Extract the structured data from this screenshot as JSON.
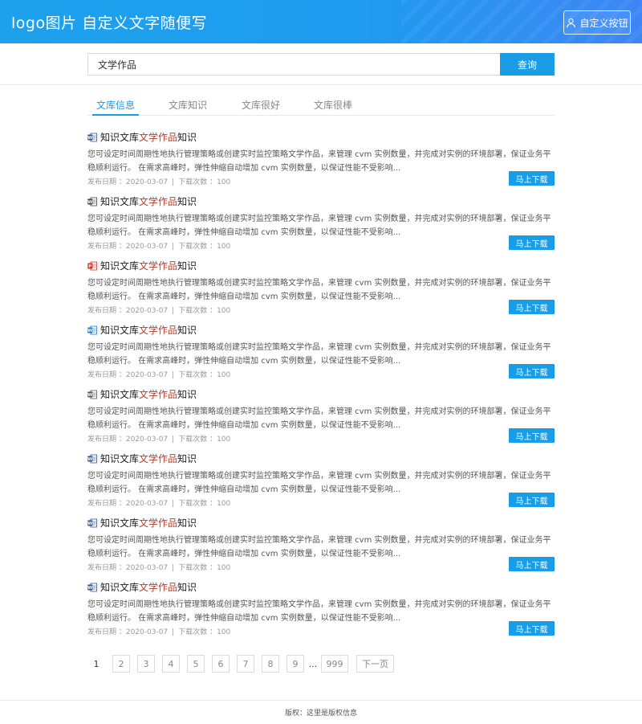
{
  "header": {
    "logo_text": "logo图片 自定义文字随便写",
    "custom_button_label": "自定义按钮",
    "accent": "#1da1ec"
  },
  "search": {
    "value": "文学作品",
    "button_label": "查询"
  },
  "tabs": [
    {
      "label": "文库信息",
      "active": true
    },
    {
      "label": "文库知识",
      "active": false
    },
    {
      "label": "文库很好",
      "active": false
    },
    {
      "label": "文库很棒",
      "active": false
    }
  ],
  "items": [
    {
      "icon": "word-doc-icon",
      "icon_color": "#2b5797",
      "title_prefix": "知识文库",
      "title_highlight": "文学作品",
      "title_suffix": "知识",
      "description": "您可设定时间周期性地执行管理策略或创建实时监控策略文学作品，来管理 cvm 实例数量，并完成对实例的环境部署，保证业务平稳顺利运行。 在需求高峰时，弹性伸缩自动增加 cvm 实例数量，以保证性能不受影响...",
      "date_label": "发布日期 ：2020-03-07",
      "downloads_label": "下载次数 ：100",
      "download_button": "马上下载"
    },
    {
      "icon": "word-doc-icon",
      "icon_color": "#444444",
      "title_prefix": "知识文库",
      "title_highlight": "文学作品",
      "title_suffix": "知识",
      "description": "您可设定时间周期性地执行管理策略或创建实时监控策略文学作品，来管理 cvm 实例数量，并完成对实例的环境部署，保证业务平稳顺利运行。 在需求高峰时，弹性伸缩自动增加 cvm 实例数量，以保证性能不受影响...",
      "date_label": "发布日期 ：2020-03-07",
      "downloads_label": "下载次数 ：100",
      "download_button": "马上下载"
    },
    {
      "icon": "ppt-doc-icon",
      "icon_color": "#c0392b",
      "title_prefix": "知识文库",
      "title_highlight": "文学作品",
      "title_suffix": "知识",
      "description": "您可设定时间周期性地执行管理策略或创建实时监控策略文学作品，来管理 cvm 实例数量，并完成对实例的环境部署，保证业务平稳顺利运行。 在需求高峰时，弹性伸缩自动增加 cvm 实例数量，以保证性能不受影响...",
      "date_label": "发布日期 ：2020-03-07",
      "downloads_label": "下载次数 ：100",
      "download_button": "马上下载"
    },
    {
      "icon": "word-doc-icon",
      "icon_color": "#1a7bd5",
      "title_prefix": "知识文库",
      "title_highlight": "文学作品",
      "title_suffix": "知识",
      "description": "您可设定时间周期性地执行管理策略或创建实时监控策略文学作品，来管理 cvm 实例数量，并完成对实例的环境部署，保证业务平稳顺利运行。 在需求高峰时，弹性伸缩自动增加 cvm 实例数量，以保证性能不受影响...",
      "date_label": "发布日期 ：2020-03-07",
      "downloads_label": "下载次数 ：100",
      "download_button": "马上下载"
    },
    {
      "icon": "word-doc-icon",
      "icon_color": "#555555",
      "title_prefix": "知识文库",
      "title_highlight": "文学作品",
      "title_suffix": "知识",
      "description": "您可设定时间周期性地执行管理策略或创建实时监控策略文学作品，来管理 cvm 实例数量，并完成对实例的环境部署，保证业务平稳顺利运行。 在需求高峰时，弹性伸缩自动增加 cvm 实例数量，以保证性能不受影响...",
      "date_label": "发布日期 ：2020-03-07",
      "downloads_label": "下载次数 ：100",
      "download_button": "马上下载"
    },
    {
      "icon": "word-doc-icon",
      "icon_color": "#2b5797",
      "title_prefix": "知识文库",
      "title_highlight": "文学作品",
      "title_suffix": "知识",
      "description": "您可设定时间周期性地执行管理策略或创建实时监控策略文学作品，来管理 cvm 实例数量，并完成对实例的环境部署，保证业务平稳顺利运行。 在需求高峰时，弹性伸缩自动增加 cvm 实例数量，以保证性能不受影响...",
      "date_label": "发布日期 ：2020-03-07",
      "downloads_label": "下载次数 ：100",
      "download_button": "马上下载"
    },
    {
      "icon": "word-doc-icon",
      "icon_color": "#2b5797",
      "title_prefix": "知识文库",
      "title_highlight": "文学作品",
      "title_suffix": "知识",
      "description": "您可设定时间周期性地执行管理策略或创建实时监控策略文学作品，来管理 cvm 实例数量，并完成对实例的环境部署，保证业务平稳顺利运行。 在需求高峰时，弹性伸缩自动增加 cvm 实例数量，以保证性能不受影响...",
      "date_label": "发布日期 ：2020-03-07",
      "downloads_label": "下载次数 ：100",
      "download_button": "马上下载"
    },
    {
      "icon": "word-doc-icon",
      "icon_color": "#2b5797",
      "title_prefix": "知识文库",
      "title_highlight": "文学作品",
      "title_suffix": "知识",
      "description": "您可设定时间周期性地执行管理策略或创建实时监控策略文学作品，来管理 cvm 实例数量，并完成对实例的环境部署，保证业务平稳顺利运行。 在需求高峰时，弹性伸缩自动增加 cvm 实例数量，以保证性能不受影响...",
      "date_label": "发布日期 ：2020-03-07",
      "downloads_label": "下载次数 ：100",
      "download_button": "马上下载"
    }
  ],
  "pagination": {
    "pages": [
      "1",
      "2",
      "3",
      "4",
      "5",
      "6",
      "7",
      "8",
      "9"
    ],
    "current": "1",
    "ellipsis": "...",
    "last_page": "999",
    "next_label": "下一页"
  },
  "footer": {
    "copyright": "版权：这里是版权信息"
  }
}
